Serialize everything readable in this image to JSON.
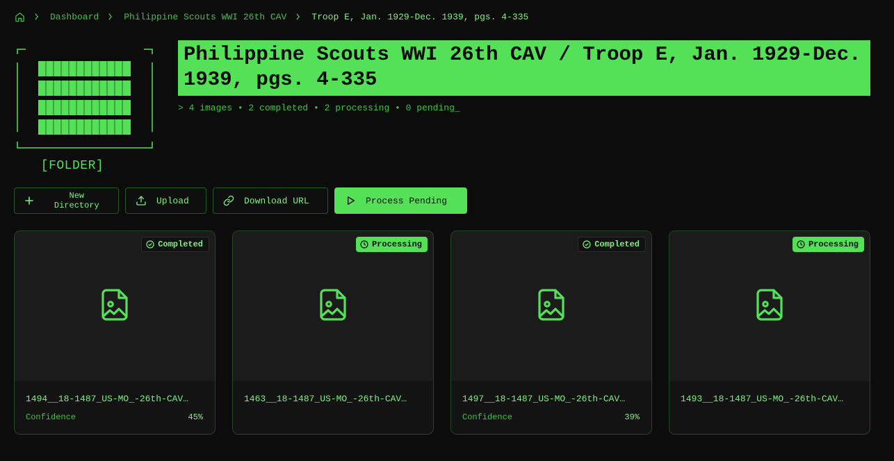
{
  "breadcrumb": {
    "home_icon": "home-icon",
    "items": [
      "Dashboard",
      "Philippine Scouts WWI 26th CAV"
    ],
    "current": "Troop E, Jan. 1929-Dec. 1939, pgs. 4-335"
  },
  "folder": {
    "label": "[FOLDER]"
  },
  "header": {
    "title": "Philippine Scouts WWI 26th CAV / Troop E, Jan. 1929-Dec. 1939, pgs. 4-335",
    "stats": "> 4 images • 2 completed • 2 processing • 0 pending_"
  },
  "toolbar": {
    "new_directory": "New Directory",
    "upload": "Upload",
    "download_url": "Download URL",
    "process_pending": "Process Pending"
  },
  "cards": [
    {
      "status": "Completed",
      "filename": "1494__18-1487_US-MO_-26th-CAV…",
      "confidence_label": "Confidence",
      "confidence": "45%"
    },
    {
      "status": "Processing",
      "filename": "1463__18-1487_US-MO_-26th-CAV…"
    },
    {
      "status": "Completed",
      "filename": "1497__18-1487_US-MO_-26th-CAV…",
      "confidence_label": "Confidence",
      "confidence": "39%"
    },
    {
      "status": "Processing",
      "filename": "1493__18-1487_US-MO_-26th-CAV…"
    }
  ],
  "colors": {
    "accent": "#54e157",
    "background": "#0c0c0c",
    "card": "#131313"
  }
}
